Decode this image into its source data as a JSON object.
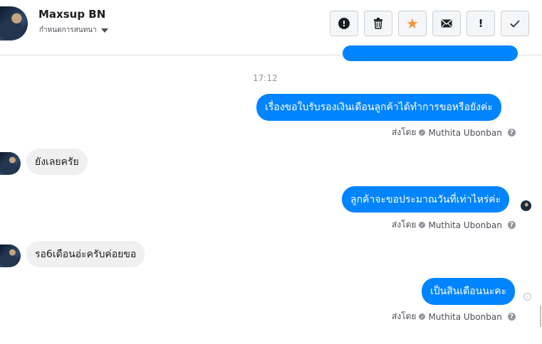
{
  "header": {
    "contact_name": "Maxsup BN",
    "subtitle": "กำหนดการสนทนา",
    "toolbar": [
      {
        "id": "report",
        "icon": "alert-circle-icon",
        "glyph": "!"
      },
      {
        "id": "delete",
        "icon": "trash-icon",
        "glyph": "🗑"
      },
      {
        "id": "star",
        "icon": "star-icon",
        "glyph": "★"
      },
      {
        "id": "mark-unread",
        "icon": "envelope-icon",
        "glyph": "✉"
      },
      {
        "id": "important",
        "icon": "exclamation-icon",
        "glyph": "!"
      },
      {
        "id": "done",
        "icon": "checkmark-icon",
        "glyph": "✓"
      }
    ]
  },
  "thread": {
    "timestamp": "17:12",
    "messages": [
      {
        "direction": "out",
        "text": "เรื่องขอใบรับรองเงินเดือนลูกค้าได้ทำการขอหรือยังค่ะ"
      },
      {
        "direction": "in",
        "text": "ยังเลยครัย"
      },
      {
        "direction": "out",
        "text": "ลูกค้าจะขอประมาณวันที่เท่าไหร่ค่ะ"
      },
      {
        "direction": "in",
        "text": "รอ6เดือนอ่ะครับค่อยขอ"
      },
      {
        "direction": "out",
        "text": "เป็นสินเดือนนะคะ"
      }
    ],
    "sent_by_label": "ส่งโดย",
    "sender_name": "Muthita Ubonban",
    "help_glyph": "?"
  },
  "colors": {
    "outgoing_bubble": "#0084ff",
    "incoming_bubble": "#f1f0f0",
    "star": "#f7923b"
  }
}
